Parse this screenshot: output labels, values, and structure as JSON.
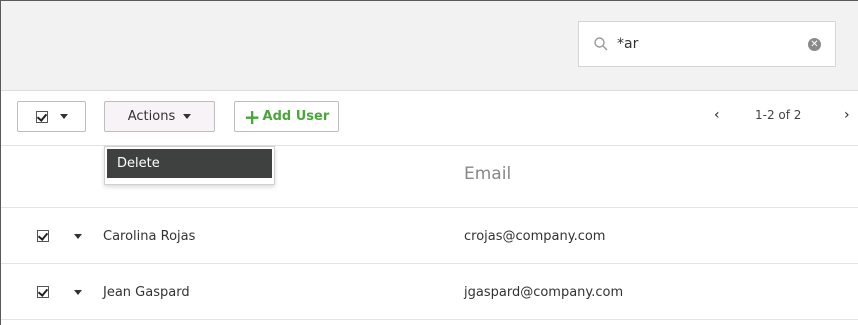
{
  "search": {
    "value": "*ar",
    "clear_symbol": "✕",
    "icon": "search-icon"
  },
  "toolbar": {
    "actions_label": "Actions",
    "add_user_label": "Add User",
    "add_icon": "+",
    "accent_color": "#4aa63a"
  },
  "pager": {
    "prev_symbol": "‹",
    "label": "1-2 of 2",
    "next_symbol": "›"
  },
  "actions_menu": {
    "items": [
      {
        "label": "Delete"
      }
    ]
  },
  "table": {
    "columns": [
      "",
      "Email"
    ],
    "rows": [
      {
        "checked": true,
        "name": "Carolina Rojas",
        "email": "crojas@company.com"
      },
      {
        "checked": true,
        "name": "Jean Gaspard",
        "email": "jgaspard@company.com"
      }
    ]
  }
}
